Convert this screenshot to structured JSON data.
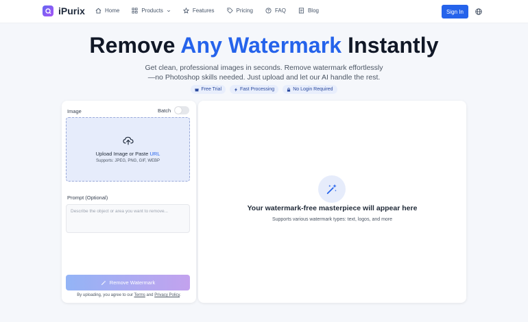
{
  "header": {
    "logo_text": "iPurix",
    "nav": [
      {
        "label": "Home",
        "icon": "home-icon"
      },
      {
        "label": "Products",
        "icon": "grid-icon",
        "has_dropdown": true
      },
      {
        "label": "Features",
        "icon": "star-icon"
      },
      {
        "label": "Pricing",
        "icon": "tag-icon"
      },
      {
        "label": "FAQ",
        "icon": "help-circle-icon"
      },
      {
        "label": "Blog",
        "icon": "document-icon"
      }
    ],
    "signin_label": "Sign In",
    "language_icon": "globe-icon"
  },
  "hero": {
    "title_before": "Remove ",
    "title_accent": "Any Watermark",
    "title_after": " Instantly",
    "subtitle_line1": "Get clean, professional images in seconds. Remove watermark effortlessly",
    "subtitle_line2": "—no Photoshop skills needed. Just upload and let our AI handle the rest.",
    "badges": [
      {
        "label": "Free Trial",
        "icon": "gift-icon"
      },
      {
        "label": "Fast Processing",
        "icon": "bolt-icon"
      },
      {
        "label": "No Login Required",
        "icon": "lock-icon"
      }
    ]
  },
  "left_panel": {
    "image_label": "Image",
    "batch_label": "Batch",
    "batch_enabled": false,
    "upload_text": "Upload Image or Paste ",
    "upload_link": "URL",
    "supports_text": "Supports: JPEG, PNG, GIF, WEBP",
    "prompt_label": "Prompt (Optional)",
    "prompt_placeholder": "Describe the object or area you want to remove...",
    "remove_button": "Remove Watermark",
    "terms_prefix": "By uploading, you agree to our ",
    "terms_link": "Terms",
    "terms_and": " and ",
    "privacy_link": "Privacy Policy",
    "terms_suffix": "."
  },
  "right_panel": {
    "title": "Your watermark-free masterpiece will appear here",
    "subtitle": "Supports various watermark types: text, logos, and more"
  },
  "colors": {
    "accent": "#2563eb",
    "badge_bg": "#e8eefc",
    "dropzone_bg": "#e6ecfb"
  }
}
